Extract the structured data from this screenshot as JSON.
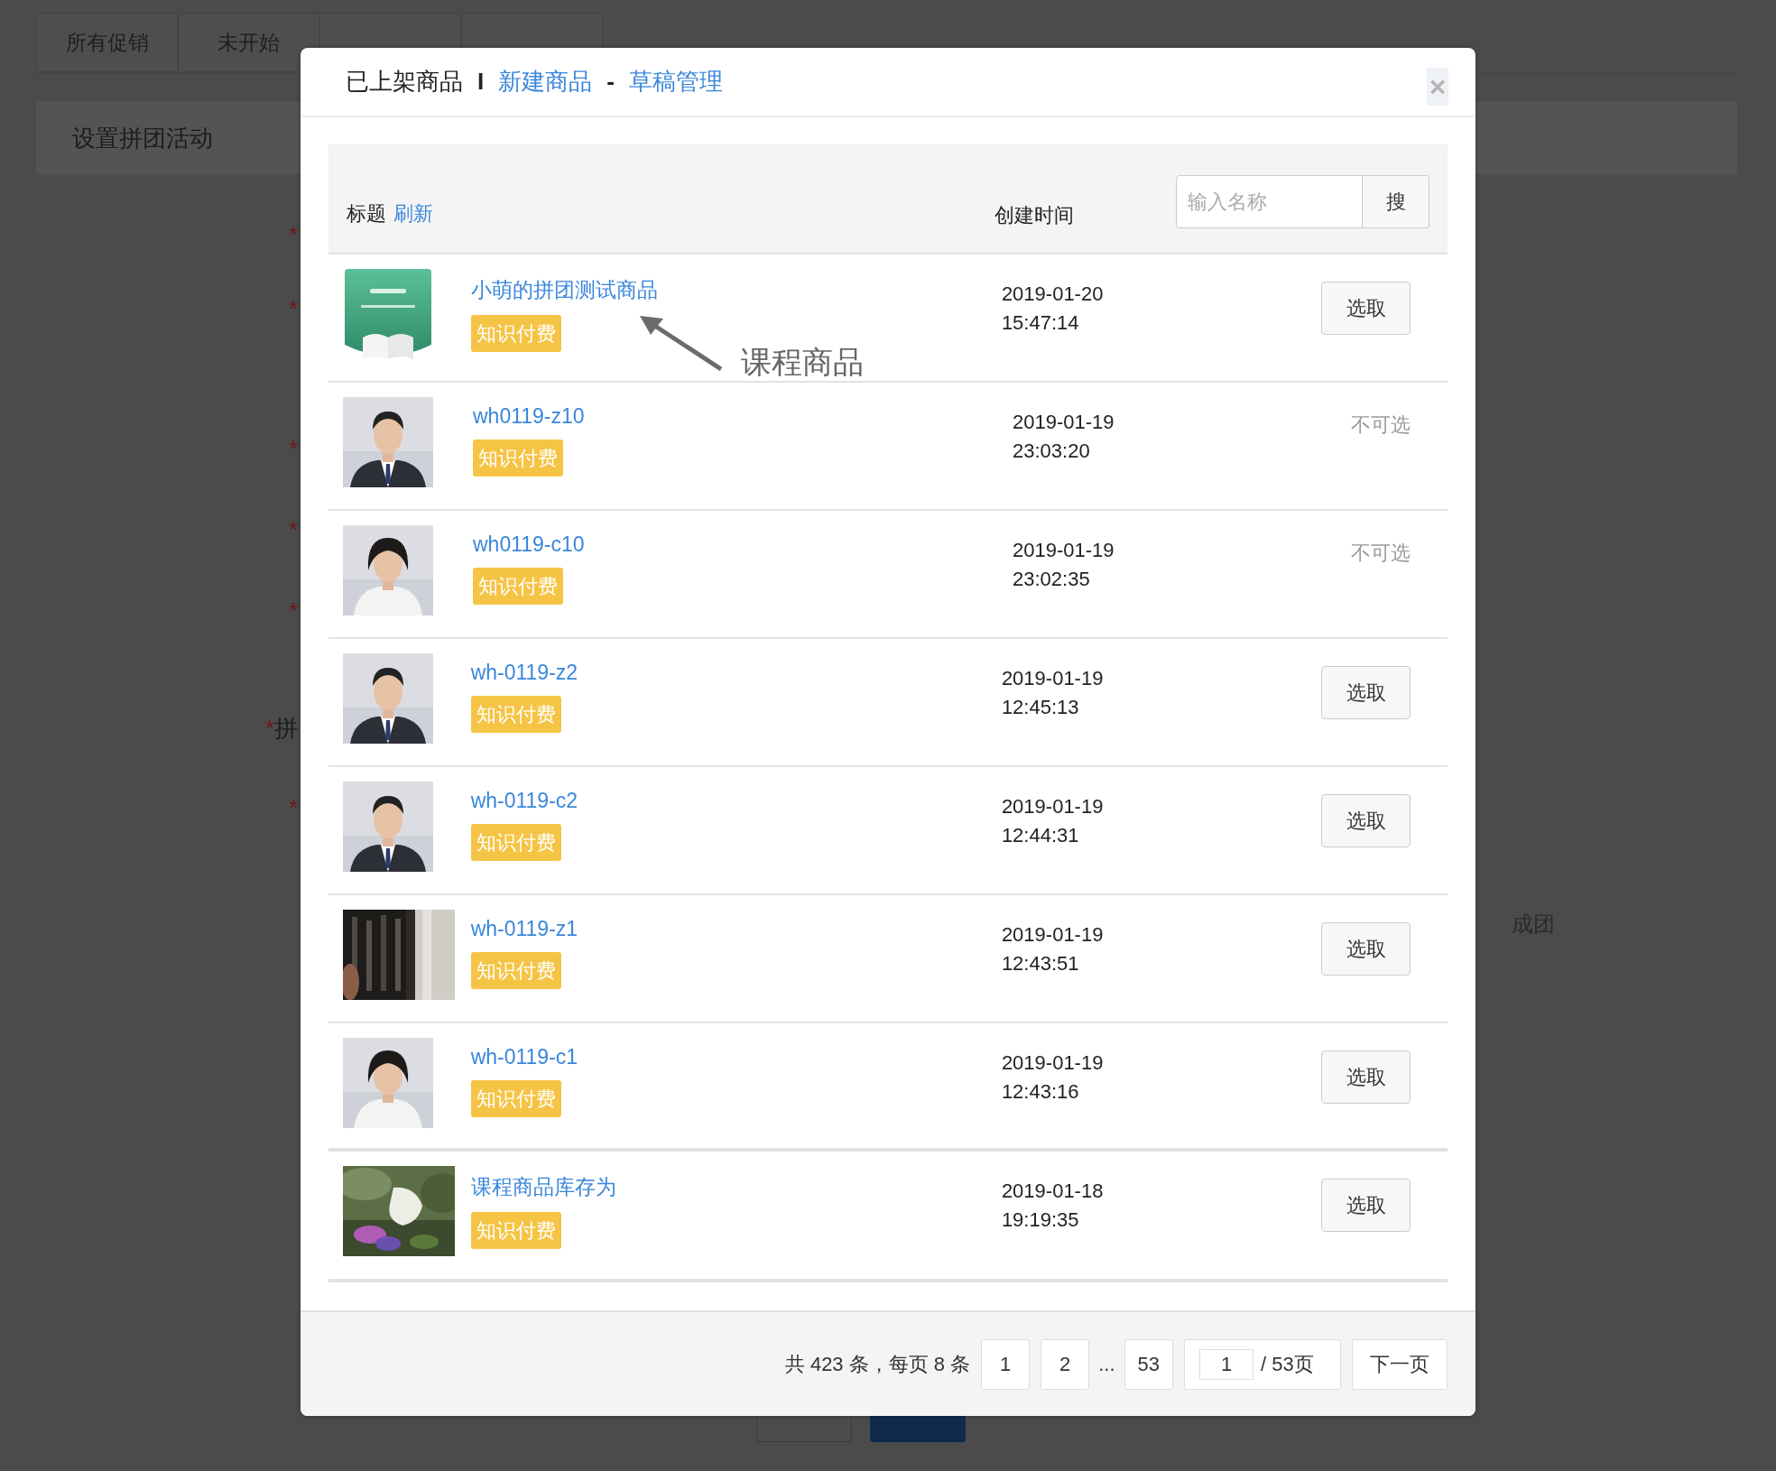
{
  "page": {
    "tabs": [
      {
        "label": "所有促销"
      },
      {
        "label": "未开始"
      }
    ],
    "section_title": "设置拼团活动",
    "form_marks": [
      "*",
      "*",
      "*",
      "*",
      "*",
      "*拼",
      "*"
    ],
    "side_text": "成团",
    "buttons": [
      {
        "kind": "default"
      },
      {
        "kind": "primary"
      }
    ]
  },
  "dialog": {
    "title": "已上架商品",
    "separator": "I",
    "links": [
      {
        "label": "新建商品"
      },
      {
        "label": "草稿管理"
      }
    ],
    "link_separator": "-",
    "close": "×",
    "table": {
      "title_label": "标题",
      "refresh": "刷新",
      "date_label": "创建时间",
      "search": {
        "placeholder": "输入名称",
        "button": "搜"
      },
      "rows": [
        {
          "title": "小萌的拼团测试商品",
          "tag": "知识付费",
          "date": "2019-01-20",
          "time": "15:47:14",
          "action": {
            "kind": "button",
            "label": "选取"
          }
        },
        {
          "title": "wh0119-z10",
          "tag": "知识付费",
          "date": "2019-01-19",
          "time": "23:03:20",
          "action": {
            "kind": "unavailable",
            "label": "不可选"
          }
        },
        {
          "title": "wh0119-c10",
          "tag": "知识付费",
          "date": "2019-01-19",
          "time": "23:02:35",
          "action": {
            "kind": "unavailable",
            "label": "不可选"
          }
        },
        {
          "title": "wh-0119-z2",
          "tag": "知识付费",
          "date": "2019-01-19",
          "time": "12:45:13",
          "action": {
            "kind": "button",
            "label": "选取"
          }
        },
        {
          "title": "wh-0119-c2",
          "tag": "知识付费",
          "date": "2019-01-19",
          "time": "12:44:31",
          "action": {
            "kind": "button",
            "label": "选取"
          }
        },
        {
          "title": "wh-0119-z1",
          "tag": "知识付费",
          "date": "2019-01-19",
          "time": "12:43:51",
          "action": {
            "kind": "button",
            "label": "选取"
          }
        },
        {
          "title": "wh-0119-c1",
          "tag": "知识付费",
          "date": "2019-01-19",
          "time": "12:43:16",
          "action": {
            "kind": "button",
            "label": "选取"
          }
        },
        {
          "title": "课程商品库存为",
          "tag": "知识付费",
          "date": "2019-01-18",
          "time": "19:19:35",
          "action": {
            "kind": "button",
            "label": "选取"
          }
        }
      ]
    },
    "annotation": {
      "label": "课程商品"
    },
    "pagination": {
      "summary": "共 423 条，每页 8 条",
      "pages": [
        {
          "kind": "page",
          "label": "1"
        },
        {
          "kind": "page",
          "label": "2"
        },
        {
          "kind": "ellipsis",
          "label": "..."
        },
        {
          "kind": "page",
          "label": "53"
        }
      ],
      "page_input": "1",
      "total": "/ 53页",
      "next": "下一页"
    }
  }
}
